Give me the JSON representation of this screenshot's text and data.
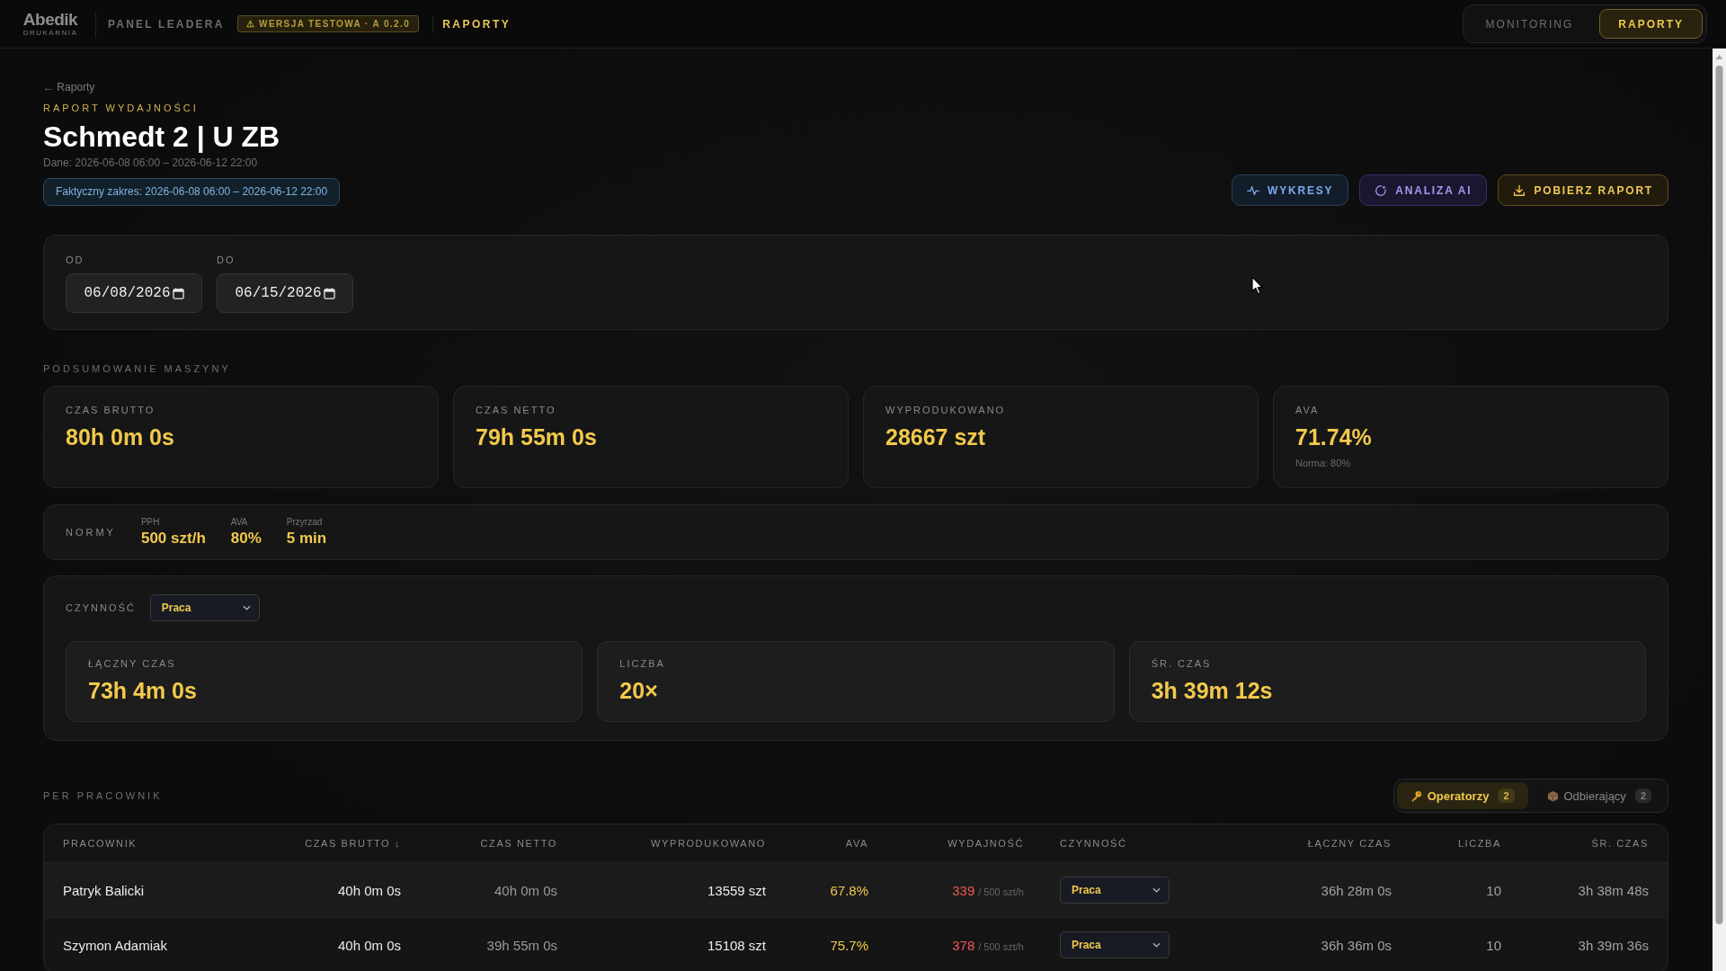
{
  "topbar": {
    "logo": {
      "name": "Abedik",
      "tagline": "DRUKARNIA"
    },
    "app_title": "PANEL LEADERA",
    "version_badge": "⚠ WERSJA TESTOWA · A 0.2.0",
    "section": "RAPORTY",
    "nav": [
      {
        "label": "MONITORING",
        "selected": false
      },
      {
        "label": "RAPORTY",
        "selected": true
      }
    ]
  },
  "header": {
    "breadcrumb": "← Raporty",
    "kicker": "RAPORT WYDAJNOŚCI",
    "title": "Schmedt 2 | U ZB",
    "data_range": "Dane: 2026-06-08 06:00 – 2026-06-12 22:00",
    "actual_range": "Faktyczny zakres: 2026-06-08 06:00 – 2026-06-12 22:00",
    "actions": [
      {
        "label": "WYKRESY",
        "kind": "charts"
      },
      {
        "label": "ANALIZA AI",
        "kind": "ai"
      },
      {
        "label": "POBIERZ RAPORT",
        "kind": "download"
      }
    ]
  },
  "date_filter": {
    "fields": [
      {
        "label": "OD",
        "value": "06/08/2026"
      },
      {
        "label": "DO",
        "value": "06/15/2026"
      }
    ]
  },
  "machine_summary": {
    "title": "PODSUMOWANIE MASZYNY",
    "cards": [
      {
        "label": "CZAS BRUTTO",
        "value": "80h 0m 0s"
      },
      {
        "label": "CZAS NETTO",
        "value": "79h 55m 0s"
      },
      {
        "label": "WYPRODUKOWANO",
        "value": "28667 szt"
      },
      {
        "label": "AVA",
        "value": "71.74%",
        "note": "Norma: 80%"
      }
    ]
  },
  "norms": {
    "label": "NORMY",
    "items": [
      {
        "label": "PPH",
        "value": "500 szt/h"
      },
      {
        "label": "AVA",
        "value": "80%"
      },
      {
        "label": "Przyrzad",
        "value": "5 min"
      }
    ]
  },
  "activity": {
    "label": "CZYNNOŚĆ",
    "select": "Praca",
    "cards": [
      {
        "label": "ŁĄCZNY CZAS",
        "value": "73h 4m 0s"
      },
      {
        "label": "LICZBA",
        "value": "20×"
      },
      {
        "label": "ŚR. CZAS",
        "value": "3h 39m 12s"
      }
    ]
  },
  "workers": {
    "title": "PER PRACOWNIK",
    "tabs": [
      {
        "label": "Operatorzy",
        "count": "2",
        "kind": "operators",
        "selected": true
      },
      {
        "label": "Odbierający",
        "count": "2",
        "kind": "receivers",
        "selected": false
      }
    ],
    "table": {
      "columns": [
        "PRACOWNIK",
        "CZAS BRUTTO ↓",
        "CZAS NETTO",
        "WYPRODUKOWANO",
        "AVA",
        "WYDAJNOŚĆ",
        "CZYNNOŚĆ",
        "ŁĄCZNY CZAS",
        "LICZBA",
        "ŚR. CZAS"
      ],
      "rows": [
        {
          "name": "Patryk Balicki",
          "gross": "40h 0m 0s",
          "net": "40h 0m 0s",
          "produced": "13559 szt",
          "ava": "67.8%",
          "efficiency": "339",
          "efficiency_norm": "/ 500 szt/h",
          "activity": "Praca",
          "total_time": "36h 28m 0s",
          "count": "10",
          "avg_time": "3h 38m 48s"
        },
        {
          "name": "Szymon Adamiak",
          "gross": "40h 0m 0s",
          "net": "39h 55m 0s",
          "produced": "15108 szt",
          "ava": "75.7%",
          "efficiency": "378",
          "efficiency_norm": "/ 500 szt/h",
          "activity": "Praca",
          "total_time": "36h 36m 0s",
          "count": "10",
          "avg_time": "3h 39m 36s"
        }
      ]
    }
  }
}
